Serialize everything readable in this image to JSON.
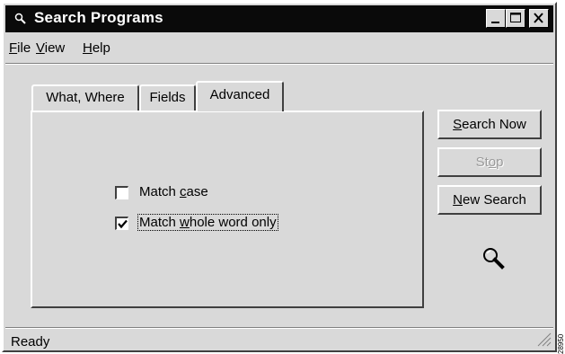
{
  "window": {
    "title": "Search Programs",
    "controls": {
      "minimize": "minimize-icon",
      "maximize": "maximize-icon",
      "close": "close-icon"
    }
  },
  "menu": {
    "items": [
      {
        "label": "File",
        "mnemonic": "F"
      },
      {
        "label": "View",
        "mnemonic": "V"
      },
      {
        "label": "Help",
        "mnemonic": "H"
      }
    ]
  },
  "tabs": [
    {
      "label": "What, Where",
      "active": false
    },
    {
      "label": "Fields",
      "active": false
    },
    {
      "label": "Advanced",
      "active": true
    }
  ],
  "options": {
    "match_case": {
      "pre": "Match ",
      "mnemonic": "c",
      "post": "ase",
      "checked": false
    },
    "match_whole_word": {
      "pre": "Match ",
      "mnemonic": "w",
      "post": "hole word only",
      "checked": true,
      "focused": true
    }
  },
  "buttons": {
    "search_now": {
      "mnemonic": "S",
      "rest": "earch Now",
      "enabled": true
    },
    "stop": {
      "pre": "St",
      "mnemonic": "o",
      "post": "p",
      "enabled": false
    },
    "new_search": {
      "mnemonic": "N",
      "rest": "ew Search",
      "enabled": true
    }
  },
  "status": {
    "text": "Ready"
  },
  "side_code": "28950",
  "colors": {
    "title_bar": "#0a0a0a",
    "face": "#d9d9d9",
    "disabled_text": "#9a9a9a"
  }
}
